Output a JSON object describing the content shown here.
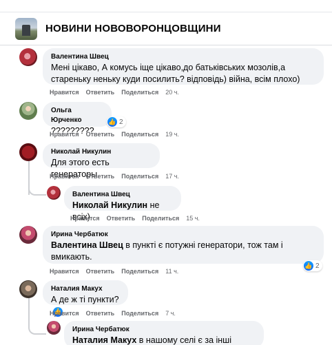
{
  "header": {
    "group_title": "НОВИНИ НОВОВОРОНЦОВЩИНИ",
    "group_icon": "group-photo"
  },
  "colors": {
    "bubble_bg": "#f0f2f5",
    "action_text": "#65676b",
    "like_blue": "#0866ff"
  },
  "comments": [
    {
      "author": "Валентина Швец",
      "text": "Мені цікаво, А комусь іще цікаво,до батьківських мозолів,а стареньку неньку куди посилить? відповідь) війна, всім плохо)",
      "actions": {
        "like": "Нравится",
        "reply": "Ответить",
        "share": "Поделиться"
      },
      "time": "20 ч."
    },
    {
      "author": "Ольга Юрченко",
      "text": "?????????",
      "reactions": "2",
      "actions": {
        "like": "Нравится",
        "reply": "Ответить",
        "share": "Поделиться"
      },
      "time": "19 ч."
    },
    {
      "author": "Николай Никулин",
      "text": "Для этого есть генераторы",
      "actions": {
        "like": "Нравится",
        "reply": "Ответить",
        "share": "Поделиться"
      },
      "time": "17 ч.",
      "reply": {
        "author": "Валентина Швец",
        "mention": "Николай Никулин",
        "text": " не всіх)",
        "actions": {
          "like": "Нравится",
          "reply": "Ответить",
          "share": "Поделиться"
        },
        "time": "15 ч."
      }
    },
    {
      "author": "Ирина Чербатюк",
      "mention": "Валентина Швец",
      "text": " в пункті є потужні генератори, тож там і вмикають.",
      "reactions": "2",
      "actions": {
        "like": "Нравится",
        "reply": "Ответить",
        "share": "Поделиться"
      },
      "time": "11 ч."
    },
    {
      "author": "Наталия Макух",
      "text": "А де ж ті пункти?",
      "actions": {
        "like": "Нравится",
        "reply": "Ответить",
        "share": "Поделиться"
      },
      "time": "7 ч.",
      "reply": {
        "author": "Ирина Чербатюк",
        "mention": "Наталия Макух",
        "text": " в нашому селі є за інші незнаю"
      }
    }
  ]
}
